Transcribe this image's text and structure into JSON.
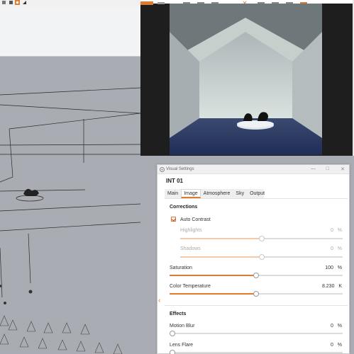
{
  "colors": {
    "accent": "#e07a2f",
    "viewport_bg": "#a9adb3"
  },
  "render_window": {
    "toolbar_icons": [
      "enscape-logo-icon",
      "menu-icon",
      "render-icon",
      "export-icon",
      "settings-icon",
      "close-icon",
      "views-icon",
      "share-icon",
      "asset-icon",
      "upload-icon"
    ]
  },
  "visual_settings": {
    "window_title": "Visual Settings",
    "preset_name": "INT 01",
    "tabs": [
      {
        "label": "Main",
        "active": false
      },
      {
        "label": "Image",
        "active": true
      },
      {
        "label": "Atmosphere",
        "active": false
      },
      {
        "label": "Sky",
        "active": false
      },
      {
        "label": "Output",
        "active": false
      }
    ],
    "corrections": {
      "heading": "Corrections",
      "auto_contrast_label": "Auto Contrast",
      "auto_contrast_checked": true,
      "sliders": [
        {
          "label": "Highlights",
          "value": "0",
          "unit": "%",
          "fraction": 0.5,
          "enabled": false
        },
        {
          "label": "Shadows",
          "value": "0",
          "unit": "%",
          "fraction": 0.5,
          "enabled": false
        },
        {
          "label": "Saturation",
          "value": "100",
          "unit": "%",
          "fraction": 0.5,
          "enabled": true
        },
        {
          "label": "Color Temperature",
          "value": "8.230",
          "unit": "K",
          "fraction": 0.5,
          "enabled": true
        }
      ]
    },
    "effects": {
      "heading": "Effects",
      "sliders": [
        {
          "label": "Motion Blur",
          "value": "0",
          "unit": "%",
          "fraction": 0.0,
          "enabled": true
        },
        {
          "label": "Lens Flare",
          "value": "0",
          "unit": "%",
          "fraction": 0.0,
          "enabled": true
        }
      ]
    }
  }
}
